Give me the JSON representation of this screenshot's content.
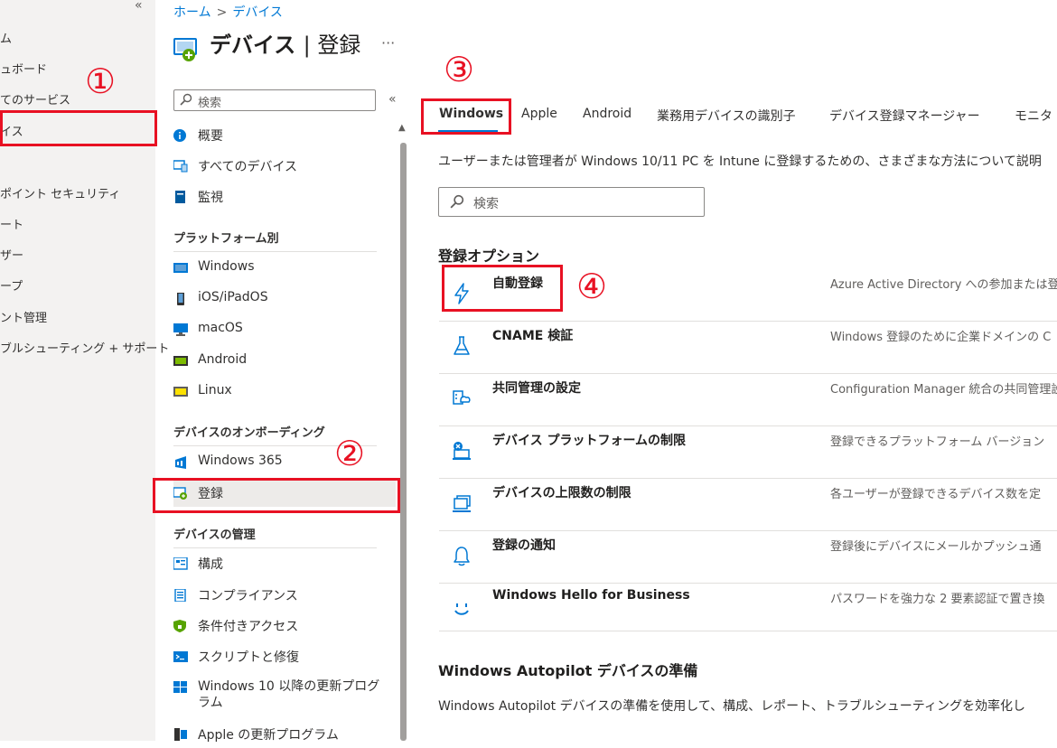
{
  "left_nav": {
    "collapse": "«",
    "items": [
      "ム",
      "ュボード",
      "てのサービス",
      "イス",
      "",
      "ポイント セキュリティ",
      "ート",
      "ザー",
      "ープ",
      "ント管理",
      "ブルシューティング + サポート"
    ]
  },
  "header": {
    "breadcrumb": [
      "ホーム",
      "デバイス"
    ],
    "title": "デバイス",
    "subtitle": "| 登録",
    "more": "···"
  },
  "side_nav": {
    "search_placeholder": "検索",
    "collapse": "«",
    "top_items": [
      "概要",
      "すべてのデバイス",
      "監視"
    ],
    "section_platform": "プラットフォーム別",
    "platform_items": [
      "Windows",
      "iOS/iPadOS",
      "macOS",
      "Android",
      "Linux"
    ],
    "section_onboarding": "デバイスのオンボーディング",
    "onboarding_items": [
      "Windows 365",
      "登録"
    ],
    "section_manage": "デバイスの管理",
    "manage_items": [
      "構成",
      "コンプライアンス",
      "条件付きアクセス",
      "スクリプトと修復",
      "Windows 10 以降の更新プログラム",
      "Apple の更新プログラム"
    ]
  },
  "tabs": [
    "Windows",
    "Apple",
    "Android",
    "業務用デバイスの識別子",
    "デバイス登録マネージャー",
    "モニタ"
  ],
  "description": "ユーザーまたは管理者が Windows 10/11 PC を Intune に登録するための、さまざまな方法について説明",
  "main_search_placeholder": "検索",
  "options_heading": "登録オプション",
  "options": [
    {
      "name": "自動登録",
      "desc": "Azure Active Directory への参加または登"
    },
    {
      "name": "CNAME 検証",
      "desc": "Windows 登録のために企業ドメインの C"
    },
    {
      "name": "共同管理の設定",
      "desc": "Configuration Manager 統合の共同管理設"
    },
    {
      "name": "デバイス プラットフォームの制限",
      "desc": "登録できるプラットフォーム バージョン"
    },
    {
      "name": "デバイスの上限数の制限",
      "desc": "各ユーザーが登録できるデバイス数を定"
    },
    {
      "name": "登録の通知",
      "desc": "登録後にデバイスにメールかプッシュ通"
    },
    {
      "name": "Windows Hello for Business",
      "desc": "パスワードを強力な 2 要素認証で置き換"
    }
  ],
  "autopilot_heading": "Windows Autopilot デバイスの準備",
  "autopilot_desc": "Windows Autopilot デバイスの準備を使用して、構成、レポート、トラブルシューティングを効率化し",
  "annotations": [
    "①",
    "②",
    "③",
    "④"
  ],
  "colors": {
    "accent": "#0078d4",
    "annotation": "#e81123",
    "nav_bg": "#f3f2f1"
  }
}
